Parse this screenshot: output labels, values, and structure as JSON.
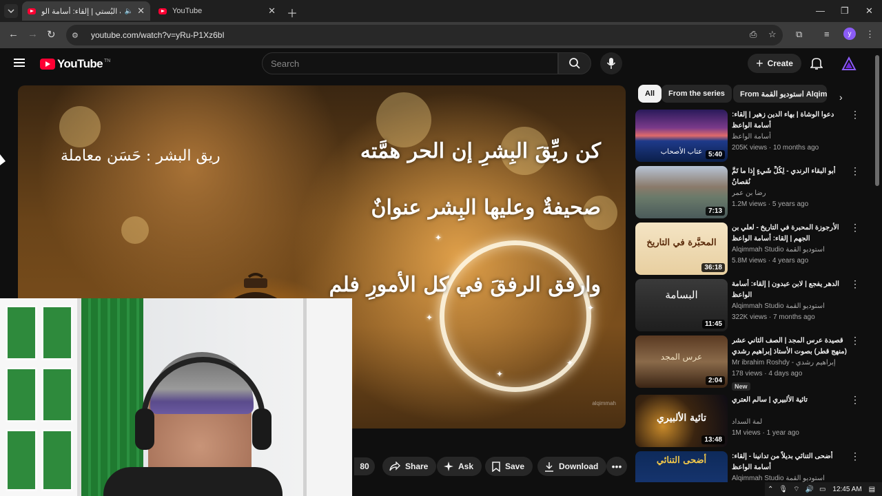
{
  "browser": {
    "tabs": [
      {
        "title": "نونية البُستي | إلقاء: أسامة الو",
        "active": true,
        "audio_icon": "speaker-icon"
      },
      {
        "title": "YouTube",
        "active": false
      }
    ],
    "new_tab_icon": "plus-icon",
    "window_controls": [
      "minimize-icon",
      "restore-icon",
      "close-icon"
    ],
    "url": "youtube.com/watch?v=yRu-P1Xz6bI",
    "profile_letter": "y"
  },
  "masthead": {
    "logo_text": "YouTube",
    "logo_superscript": "TN",
    "search_placeholder": "Search",
    "create_label": "Create"
  },
  "player": {
    "poem_title": "ريق البشر : حَسَن معاملة",
    "verses": [
      "كن ريِّقَ البِشرِ إن الحر همَّته",
      "صحيفةٌ وعليها البِشر عنوانٌ",
      "وارفق الرفقَ في كل الأمورِ فلم"
    ],
    "watermark": "alqimmah"
  },
  "actions": {
    "like_count": "80",
    "share_label": "Share",
    "ask_label": "Ask",
    "save_label": "Save",
    "download_label": "Download"
  },
  "sidebar": {
    "chips": [
      "All",
      "From the series",
      "From استوديو القمة Alqimmah"
    ],
    "recommendations": [
      {
        "title": "دعوا الوشاة | بهاء الدين زهير | إلقاء: أسامة الواعظ",
        "channel": "أسامة الواعظ",
        "views": "205K views",
        "age": "10 months ago",
        "duration": "5:40",
        "thumb_text": "عتاب الأصحاب",
        "badge": ""
      },
      {
        "title": "أبو البقاء الرندي - لِكُلِّ شَيءٍ إِذا ما تَمَّ نُقصانُ",
        "channel": "رضا بن عمر",
        "views": "1.2M views",
        "age": "5 years ago",
        "duration": "7:13",
        "thumb_text": "",
        "badge": ""
      },
      {
        "title": "الأرجوزة المحبرة في التاريخ - لعلي بن الجهم | إلقاء: أسامة الواعظ",
        "channel": "Alqimmah Studio استوديو القمة",
        "views": "5.8M views",
        "age": "4 years ago",
        "duration": "36:18",
        "thumb_text": "المحبَّرة في التاريخ",
        "badge": ""
      },
      {
        "title": "الدهر يفجع | لابن عبدون | إلقاء: أسامة الواعظ",
        "channel": "Alqimmah Studio استوديو القمة",
        "views": "322K views",
        "age": "7 months ago",
        "duration": "11:45",
        "thumb_text": "البسامة",
        "badge": ""
      },
      {
        "title": "قصيدة عرس المجد | الصف الثاني عشر (منهج قطر) بصوت الأستاذ إبراهيم رشدي",
        "channel": "Mr ibrahim Roshdy - إبراهيم رشدي",
        "views": "178 views",
        "age": "4 days ago",
        "duration": "2:04",
        "thumb_text": "عرس المجد",
        "badge": "New"
      },
      {
        "title": "تائية الألبيري | سالم العتري",
        "channel": "لمة السداد",
        "views": "1M views",
        "age": "1 year ago",
        "duration": "13:48",
        "thumb_text": "تائية الألبيري",
        "badge": ""
      },
      {
        "title": "أضحى التنائي بديلاً من تدانينا - إلقاء: أسامة الواعظ",
        "channel": "Alqimmah Studio استوديو القمة",
        "views": "",
        "age": "",
        "duration": "",
        "thumb_text": "أضحى التنائي",
        "badge": ""
      }
    ]
  },
  "taskbar": {
    "time": "12:45 AM"
  },
  "colors": {
    "yt_red": "#ff0033",
    "background": "#0f0f0f",
    "chip_bg": "#272727",
    "profile_purple": "#8b5cf6"
  }
}
